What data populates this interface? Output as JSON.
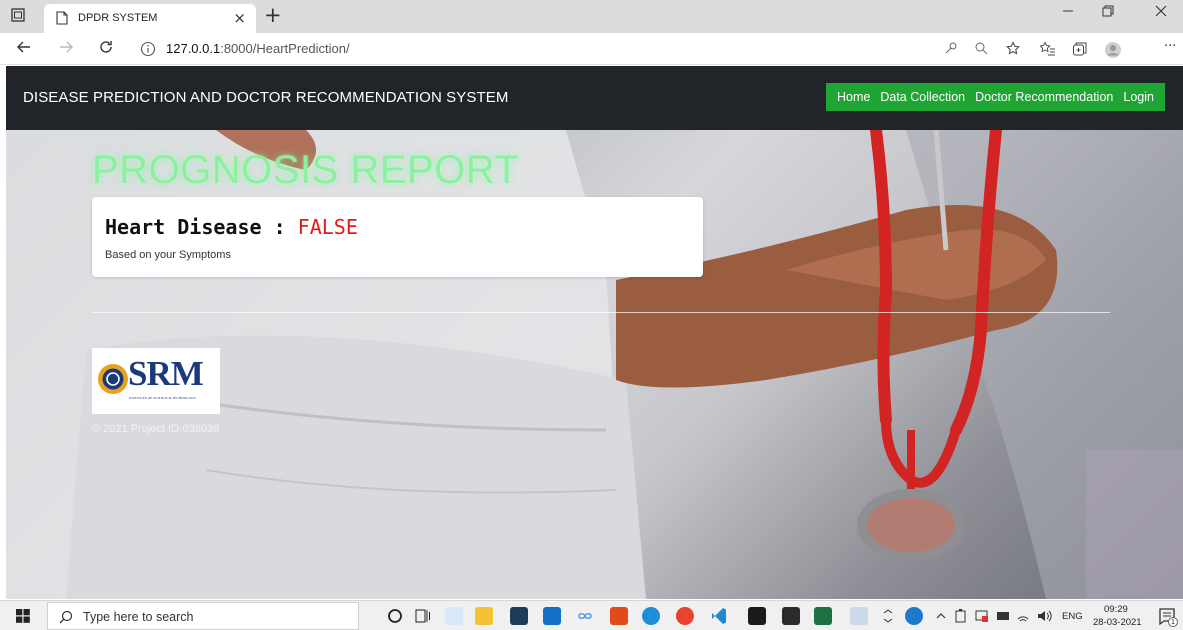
{
  "browser": {
    "tab_title": "DPDR SYSTEM",
    "tab_close": "×",
    "new_tab": "+",
    "url_host": "127.0.0.1",
    "url_rest": ":8000/HeartPrediction/",
    "more": "···"
  },
  "site": {
    "brand": "DISEASE PREDICTION AND DOCTOR RECOMMENDATION SYSTEM",
    "nav": [
      "Home",
      "Data Collection",
      "Doctor Recommendation",
      "Login"
    ]
  },
  "report": {
    "title": "PROGNOSIS REPORT",
    "disease": "Heart Disease",
    "separator": " : ",
    "verdict": "FALSE",
    "subtitle": "Based on your Symptoms"
  },
  "footer": {
    "logo_text": "SRM",
    "logo_tagline": "INSTITUTE OF SCIENCE & TECHNOLOGY",
    "copyright": "© 2021 Project ID-036038"
  },
  "taskbar": {
    "search_placeholder": "Type here to search",
    "language": "ENG",
    "time": "09:29",
    "date": "28-03-2021",
    "notification_count": "1"
  },
  "colors": {
    "nav_bg": "#212529",
    "menu_bg": "#1fa533",
    "title_glow": "#8cf0a0",
    "verdict": "#e01b1b"
  }
}
